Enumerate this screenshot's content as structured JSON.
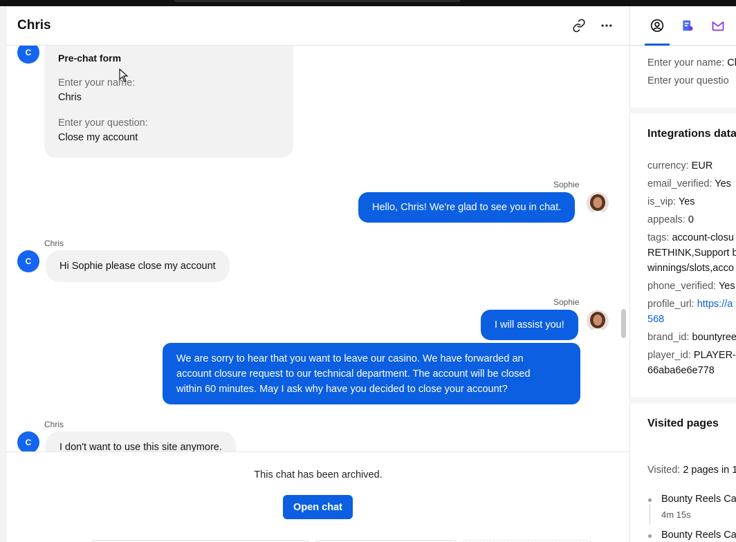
{
  "header": {
    "title": "Chris",
    "link_icon": "link-icon",
    "more_icon": "more-horizontal-icon"
  },
  "prechat": {
    "avatar_letter": "C",
    "title": "Pre-chat form",
    "name_label": "Enter your name:",
    "name_value": "Chris",
    "question_label": "Enter your question:",
    "question_value": "Close my account"
  },
  "messages": [
    {
      "author": "Sophie",
      "text": "Hello, Chris! We're glad to see you in chat."
    },
    {
      "author": "Chris",
      "avatar_letter": "C",
      "text": "Hi Sophie please close my account"
    },
    {
      "author": "Sophie",
      "text": "I will assist you!"
    },
    {
      "author": "Sophie",
      "lines": [
        "We are sorry to hear that you want to leave our casino. We have forwarded an",
        "account closure request to our technical department. The account will be closed",
        "within 60 minutes. May I ask why have you decided to close your account?"
      ]
    },
    {
      "author": "Chris",
      "avatar_letter": "C",
      "text": "I don't want to use this site anymore."
    }
  ],
  "archived": {
    "notice": "This chat has been archived.",
    "open_button": "Open chat"
  },
  "sidebar": {
    "tabs": [
      "user-circle-icon",
      "ticket-icon",
      "integration-icon"
    ],
    "prechat_rows": [
      {
        "key": "Enter your name:",
        "value": "Cl"
      },
      {
        "key": "Enter your questio",
        "value": ""
      }
    ],
    "integrations": {
      "title": "Integrations data",
      "rows": [
        {
          "key": "currency:",
          "value": "EUR"
        },
        {
          "key": "email_verified:",
          "value": "Yes"
        },
        {
          "key": "is_vip:",
          "value": "Yes"
        },
        {
          "key": "appeals:",
          "value": "0"
        },
        {
          "key": "tags:",
          "value": "account-closu",
          "cont": [
            "RETHINK,Support b",
            "winnings/slots,acco"
          ]
        },
        {
          "key": "phone_verified:",
          "value": "Yes"
        },
        {
          "key": "profile_url:",
          "value": "https://a",
          "cont": [
            "568"
          ]
        },
        {
          "key": "brand_id:",
          "value": "bountyree"
        },
        {
          "key": "player_id:",
          "value": "PLAYER-8",
          "cont": [
            "66aba6e6e778"
          ]
        }
      ]
    },
    "visited": {
      "title": "Visited pages",
      "summary_key": "Visited:",
      "summary_value": "2 pages in 1",
      "pages": [
        {
          "title": "Bounty Reels Ca",
          "duration": "4m 15s"
        },
        {
          "title": "Bounty Reels Ca",
          "duration": ""
        }
      ]
    }
  }
}
